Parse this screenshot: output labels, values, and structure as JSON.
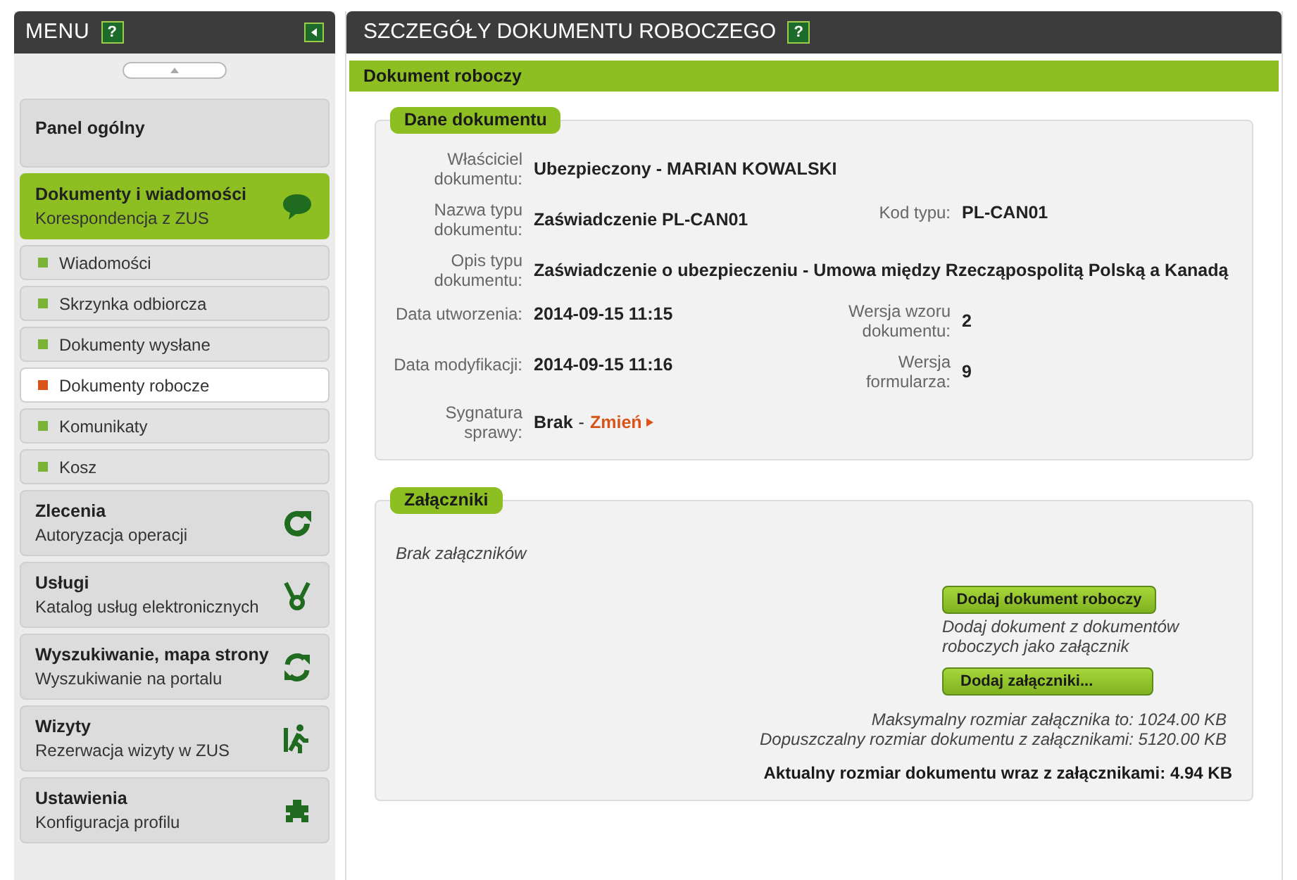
{
  "sidebar": {
    "title": "MENU",
    "help": "?",
    "items": [
      {
        "title": "Panel ogólny",
        "selected": false
      },
      {
        "title": "Dokumenty i wiadomości",
        "subtitle": "Korespondencja z ZUS",
        "selected": true,
        "children": [
          {
            "label": "Wiadomości",
            "selected": false
          },
          {
            "label": "Skrzynka odbiorcza",
            "selected": false
          },
          {
            "label": "Dokumenty wysłane",
            "selected": false
          },
          {
            "label": "Dokumenty robocze",
            "selected": true
          },
          {
            "label": "Komunikaty",
            "selected": false
          },
          {
            "label": "Kosz",
            "selected": false
          }
        ]
      },
      {
        "title": "Zlecenia",
        "subtitle": "Autoryzacja operacji",
        "selected": false
      },
      {
        "title": "Usługi",
        "subtitle": "Katalog usług elektronicznych",
        "selected": false
      },
      {
        "title": "Wyszukiwanie, mapa strony",
        "subtitle": "Wyszukiwanie na portalu",
        "selected": false
      },
      {
        "title": "Wizyty",
        "subtitle": "Rezerwacja wizyty w ZUS",
        "selected": false
      },
      {
        "title": "Ustawienia",
        "subtitle": "Konfiguracja profilu",
        "selected": false
      }
    ]
  },
  "main": {
    "title": "SZCZEGÓŁY DOKUMENTU ROBOCZEGO",
    "help": "?",
    "panel_title": "Dokument roboczy",
    "details": {
      "legend": "Dane dokumentu",
      "rows": [
        {
          "fields": [
            {
              "label": "Właściciel dokumentu:",
              "value": "Ubezpieczony - MARIAN KOWALSKI"
            }
          ]
        },
        {
          "fields": [
            {
              "label": "Nazwa typu dokumentu:",
              "value": "Zaświadczenie PL-CAN01"
            },
            {
              "label": "Kod typu:",
              "value": "PL-CAN01"
            }
          ]
        },
        {
          "fields": [
            {
              "label": "Opis typu dokumentu:",
              "value": "Zaświadczenie o ubezpieczeniu - Umowa między Rzecząpospolitą Polską a Kanadą"
            }
          ]
        },
        {
          "fields": [
            {
              "label": "Data utworzenia:",
              "value": "2014-09-15 11:15"
            },
            {
              "label": "Wersja wzoru dokumentu:",
              "value": "2"
            }
          ]
        },
        {
          "fields": [
            {
              "label": "Data modyfikacji:",
              "value": "2014-09-15 11:16"
            },
            {
              "label": "Wersja formularza:",
              "value": "9"
            }
          ]
        },
        {
          "fields": [
            {
              "label": "Sygnatura sprawy:",
              "value": "Brak",
              "separator": "-",
              "link": "Zmień"
            }
          ]
        }
      ]
    },
    "attachments": {
      "legend": "Załączniki",
      "empty": "Brak załączników",
      "add_draft_button": "Dodaj dokument roboczy",
      "add_draft_hint": "Dodaj dokument z dokumentów roboczych jako załącznik",
      "add_button": "Dodaj załączniki...",
      "max_size": "Maksymalny rozmiar załącznika to: 1024.00 KB",
      "allowed_size": "Dopuszczalny rozmiar dokumentu z załącznikami: 5120.00 KB",
      "current_size": "Aktualny rozmiar dokumentu wraz z załącznikami: 4.94 KB"
    }
  }
}
